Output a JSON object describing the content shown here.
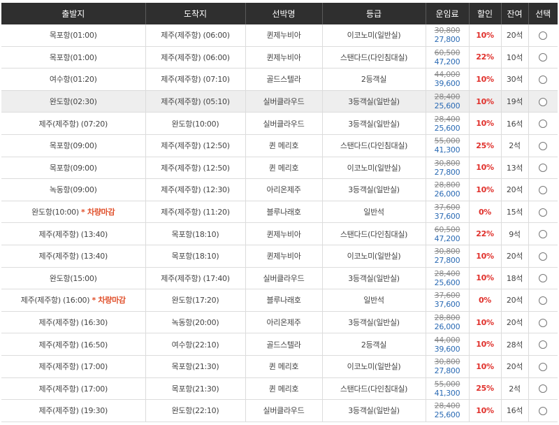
{
  "headers": [
    "출발지",
    "도착지",
    "선박명",
    "등급",
    "운임료",
    "할인",
    "잔여",
    "선택"
  ],
  "rows": [
    {
      "dep": "목포항(01:00)",
      "dep_note": "",
      "arr": "제주(제주항) (06:00)",
      "ship": "퀸제누비아",
      "grade": "이코노미(일반실)",
      "orig": "30,800",
      "fare": "27,800",
      "disc": "10%",
      "seats": "20석"
    },
    {
      "dep": "목포항(01:00)",
      "dep_note": "",
      "arr": "제주(제주항) (06:00)",
      "ship": "퀸제누비아",
      "grade": "스탠다드(다인침대실)",
      "orig": "60,500",
      "fare": "47,200",
      "disc": "22%",
      "seats": "10석"
    },
    {
      "dep": "여수항(01:20)",
      "dep_note": "",
      "arr": "제주(제주항) (07:10)",
      "ship": "골드스텔라",
      "grade": "2등객실",
      "orig": "44,000",
      "fare": "39,600",
      "disc": "10%",
      "seats": "30석"
    },
    {
      "dep": "완도항(02:30)",
      "dep_note": "",
      "arr": "제주(제주항) (05:10)",
      "ship": "실버클라우드",
      "grade": "3등객실(일반실)",
      "orig": "28,400",
      "fare": "25,600",
      "disc": "10%",
      "seats": "19석"
    },
    {
      "dep": "제주(제주항) (07:20)",
      "dep_note": "",
      "arr": "완도항(10:00)",
      "ship": "실버클라우드",
      "grade": "3등객실(일반실)",
      "orig": "28,400",
      "fare": "25,600",
      "disc": "10%",
      "seats": "16석"
    },
    {
      "dep": "목포항(09:00)",
      "dep_note": "",
      "arr": "제주(제주항) (12:50)",
      "ship": "퀸 메리호",
      "grade": "스탠다드(다인침대실)",
      "orig": "55,000",
      "fare": "41,300",
      "disc": "25%",
      "seats": "2석"
    },
    {
      "dep": "목포항(09:00)",
      "dep_note": "",
      "arr": "제주(제주항) (12:50)",
      "ship": "퀸 메리호",
      "grade": "이코노미(일반실)",
      "orig": "30,800",
      "fare": "27,800",
      "disc": "10%",
      "seats": "13석"
    },
    {
      "dep": "녹동항(09:00)",
      "dep_note": "",
      "arr": "제주(제주항) (12:30)",
      "ship": "아리온제주",
      "grade": "3등객실(일반실)",
      "orig": "28,800",
      "fare": "26,000",
      "disc": "10%",
      "seats": "20석"
    },
    {
      "dep": "완도항(10:00)",
      "dep_note": "* 차량마감",
      "arr": "제주(제주항) (11:20)",
      "ship": "블루나래호",
      "grade": "일반석",
      "orig": "37,600",
      "fare": "37,600",
      "disc": "0%",
      "seats": "15석"
    },
    {
      "dep": "제주(제주항) (13:40)",
      "dep_note": "",
      "arr": "목포항(18:10)",
      "ship": "퀸제누비아",
      "grade": "스탠다드(다인침대실)",
      "orig": "60,500",
      "fare": "47,200",
      "disc": "22%",
      "seats": "9석"
    },
    {
      "dep": "제주(제주항) (13:40)",
      "dep_note": "",
      "arr": "목포항(18:10)",
      "ship": "퀸제누비아",
      "grade": "이코노미(일반실)",
      "orig": "30,800",
      "fare": "27,800",
      "disc": "10%",
      "seats": "20석"
    },
    {
      "dep": "완도항(15:00)",
      "dep_note": "",
      "arr": "제주(제주항) (17:40)",
      "ship": "실버클라우드",
      "grade": "3등객실(일반실)",
      "orig": "28,400",
      "fare": "25,600",
      "disc": "10%",
      "seats": "18석"
    },
    {
      "dep": "제주(제주항) (16:00)",
      "dep_note": "* 차량마감",
      "arr": "완도항(17:20)",
      "ship": "블루나래호",
      "grade": "일반석",
      "orig": "37,600",
      "fare": "37,600",
      "disc": "0%",
      "seats": "20석"
    },
    {
      "dep": "제주(제주항) (16:30)",
      "dep_note": "",
      "arr": "녹동항(20:00)",
      "ship": "아리온제주",
      "grade": "3등객실(일반실)",
      "orig": "28,800",
      "fare": "26,000",
      "disc": "10%",
      "seats": "20석"
    },
    {
      "dep": "제주(제주항) (16:50)",
      "dep_note": "",
      "arr": "여수항(22:10)",
      "ship": "골드스텔라",
      "grade": "2등객실",
      "orig": "44,000",
      "fare": "39,600",
      "disc": "10%",
      "seats": "28석"
    },
    {
      "dep": "제주(제주항) (17:00)",
      "dep_note": "",
      "arr": "목포항(21:30)",
      "ship": "퀸 메리호",
      "grade": "이코노미(일반실)",
      "orig": "30,800",
      "fare": "27,800",
      "disc": "10%",
      "seats": "20석"
    },
    {
      "dep": "제주(제주항) (17:00)",
      "dep_note": "",
      "arr": "목포항(21:30)",
      "ship": "퀸 메리호",
      "grade": "스탠다드(다인침대실)",
      "orig": "55,000",
      "fare": "41,300",
      "disc": "25%",
      "seats": "2석"
    },
    {
      "dep": "제주(제주항) (19:30)",
      "dep_note": "",
      "arr": "완도항(22:10)",
      "ship": "실버클라우드",
      "grade": "3등객실(일반실)",
      "orig": "28,400",
      "fare": "25,600",
      "disc": "10%",
      "seats": "16석"
    }
  ],
  "highlighted_row": 3,
  "colors": {
    "header_bg": "#2f2f2f",
    "discount": "#e0302b",
    "fare": "#2a6ab4",
    "note": "#e0502b",
    "highlight": "#eeeeee"
  }
}
